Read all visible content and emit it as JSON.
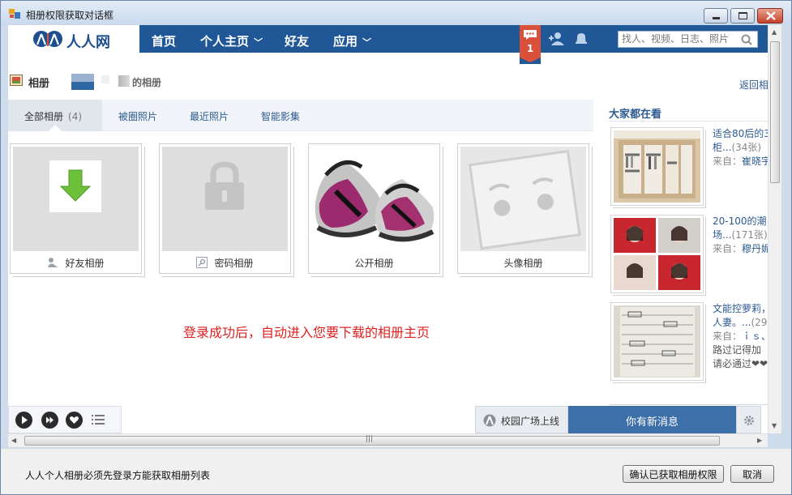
{
  "window": {
    "title": "相册权限获取对话框"
  },
  "nav": {
    "logo": "人人网",
    "items": [
      {
        "label": "首页"
      },
      {
        "label": "个人主页"
      },
      {
        "label": "好友"
      },
      {
        "label": "应用"
      }
    ],
    "notification_count": "1",
    "search_placeholder": "找人、视频、日志、照片"
  },
  "page": {
    "title": "相册",
    "owner_suffix": "的相册",
    "back_link": "返回相"
  },
  "tabs": {
    "items": [
      {
        "label": "全部相册",
        "count": "(4)"
      },
      {
        "label": "被圈照片"
      },
      {
        "label": "最近照片"
      },
      {
        "label": "智能影集"
      }
    ]
  },
  "albums": [
    {
      "label": "好友相册",
      "icon": "friend-icon"
    },
    {
      "label": "密码相册",
      "icon": "lock-icon"
    },
    {
      "label": "公开相册",
      "icon": ""
    },
    {
      "label": "头像相册",
      "icon": ""
    }
  ],
  "center_message": "登录成功后，自动进入您要下载的相册主页",
  "sidebar": {
    "title": "大家都在看",
    "items": [
      {
        "line1": "适合80后的3",
        "line2": "柜...",
        "count": "(34张)",
        "from_label": "来自：",
        "from": "崔晓宇"
      },
      {
        "line1": "20-100的潮",
        "line2": "场...",
        "count": "(171张)",
        "from_label": "来自：",
        "from": "穆丹妮"
      },
      {
        "line1": "文能控萝莉，",
        "line2": "人妻。...",
        "count": "(29",
        "from_label": "来自：",
        "from": "ｉｓ、",
        "line4": "路过记得加",
        "line5": "请必通过❤❤"
      }
    ]
  },
  "bottom": {
    "campus": "校园广场上线",
    "new_message": "你有新消息"
  },
  "footer": {
    "notice": "人人个人相册必须先登录方能获取相册列表",
    "confirm": "确认已获取相册权限",
    "cancel": "取消"
  },
  "colors": {
    "nav_bg": "#205796",
    "link": "#2c5a92",
    "alert": "#e02020",
    "notif": "#d9503b"
  }
}
